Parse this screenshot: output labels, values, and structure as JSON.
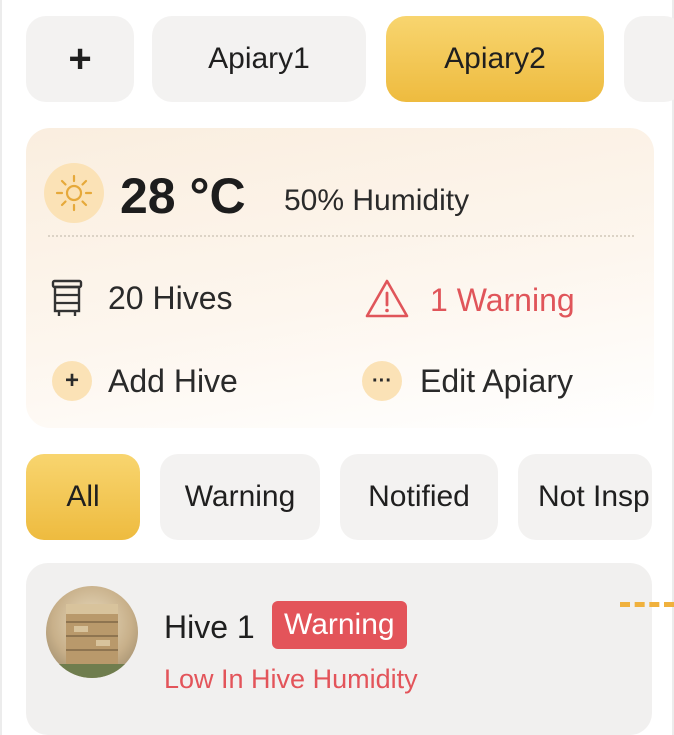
{
  "apiary_tabs": {
    "add_label": "+",
    "tabs": [
      {
        "label": "Apiary1",
        "active": false
      },
      {
        "label": "Apiary2",
        "active": true
      }
    ]
  },
  "weather": {
    "icon": "sun-icon",
    "temperature": "28 °C",
    "humidity": "50% Humidity"
  },
  "summary": {
    "hives_icon": "beehive-icon",
    "hives_label": "20 Hives",
    "warning_icon": "warning-triangle-icon",
    "warning_label": "1 Warning",
    "add_hive_icon": "+",
    "add_hive_label": "Add Hive",
    "edit_apiary_icon": "···",
    "edit_apiary_label": "Edit Apiary"
  },
  "filters": [
    {
      "label": "All",
      "active": true
    },
    {
      "label": "Warning",
      "active": false
    },
    {
      "label": "Notified",
      "active": false
    },
    {
      "label": "Not Insp",
      "active": false
    }
  ],
  "hives": [
    {
      "name": "Hive 1",
      "badge": "Warning",
      "message": "Low In Hive Humidity",
      "avatar": "hive-photo"
    }
  ],
  "colors": {
    "accent": "#F2C14E",
    "warning": "#E3545A",
    "card_bg": "#F3F2F1"
  }
}
